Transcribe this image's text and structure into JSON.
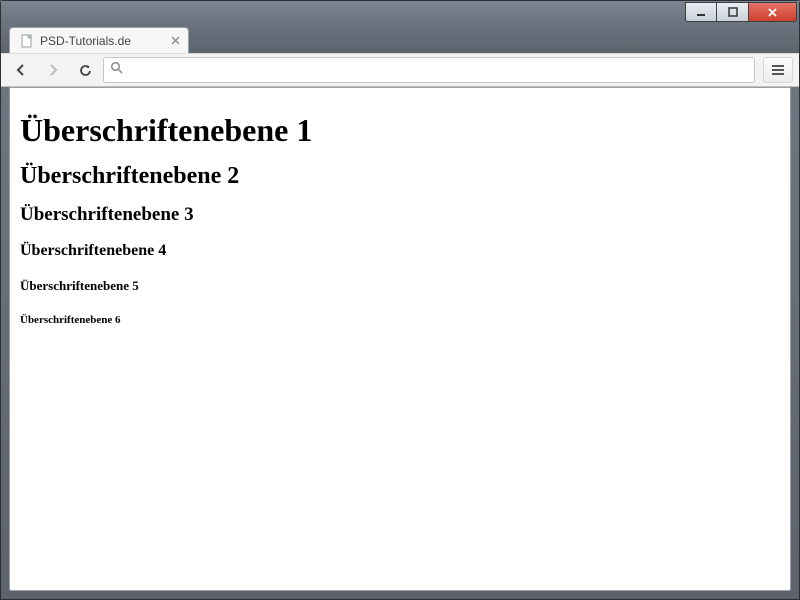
{
  "window": {
    "controls": {
      "minimize": "minimize",
      "maximize": "maximize",
      "close": "close"
    }
  },
  "tab": {
    "title": "PSD-Tutorials.de"
  },
  "toolbar": {
    "address_value": "",
    "address_placeholder": ""
  },
  "page": {
    "h1": "Überschriftenebene 1",
    "h2": "Überschriftenebene 2",
    "h3": "Überschriftenebene 3",
    "h4": "Überschriftenebene 4",
    "h5": "Überschriftenebene 5",
    "h6": "Überschriftenebene 6"
  }
}
